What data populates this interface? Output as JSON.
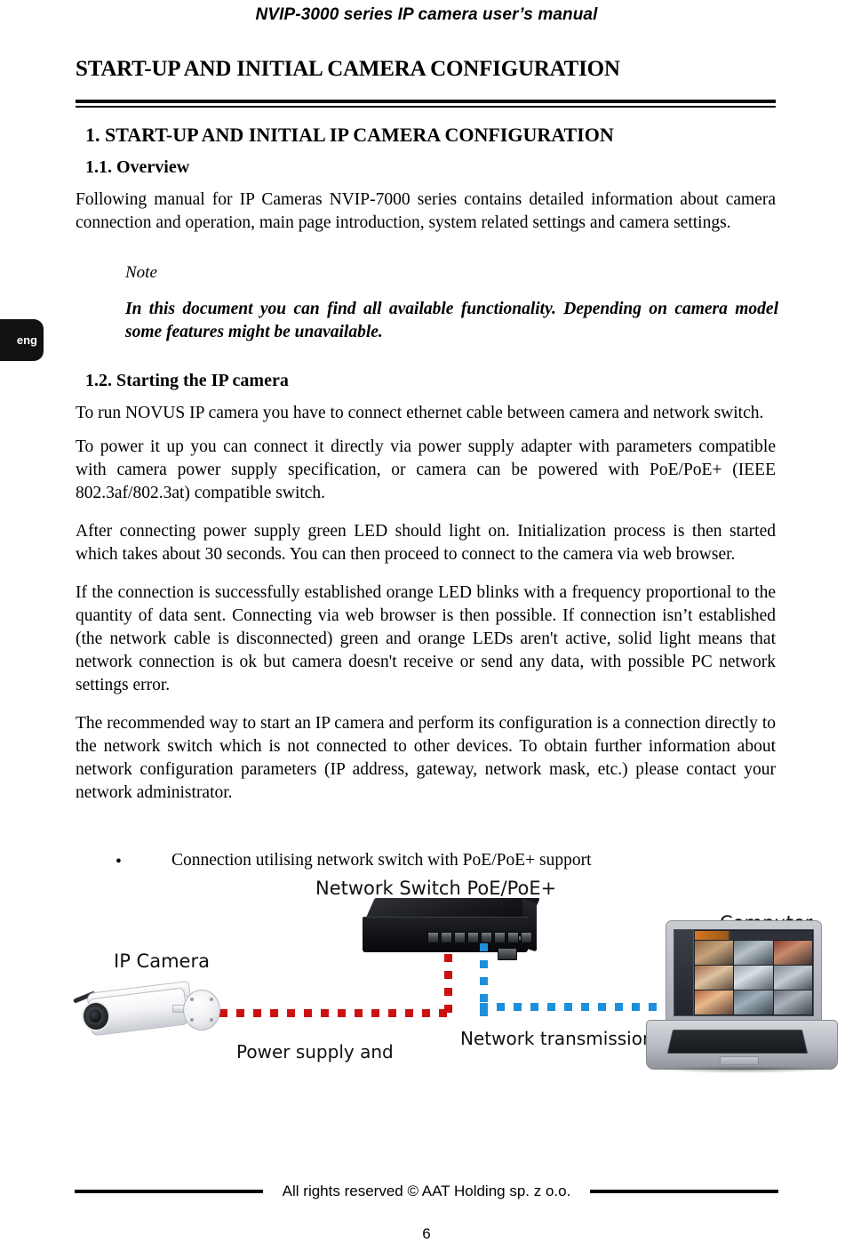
{
  "header": {
    "running_title": "NVIP-3000 series IP camera user’s manual"
  },
  "document": {
    "title": "START-UP AND INITIAL CAMERA CONFIGURATION",
    "section_1_heading": "1. START-UP AND INITIAL IP CAMERA CONFIGURATION",
    "section_1_1_heading": "1.1. Overview",
    "section_1_1_paragraph": "Following manual for IP Cameras NVIP-7000 series contains detailed information about camera connection and operation, main page introduction, system related settings and camera settings.",
    "note_label": "Note",
    "note_text": "In this document you can find all available functionality. Depending on camera model some features might be unavailable.",
    "section_1_2_heading": "1.2. Starting the IP camera",
    "paragraphs": [
      "To run NOVUS IP camera you have to connect ethernet cable between camera and network switch.",
      "To power it up you can connect it directly via power supply adapter with parameters compatible with camera power supply specification, or camera can be powered with PoE/PoE+ (IEEE 802.3af/802.3at) compatible switch.",
      "After connecting power supply green LED should light on. Initialization  process is then started which takes about 30 seconds. You can then proceed to connect to the camera via web browser.",
      "If the connection is successfully established orange LED  blinks with a frequency proportional to the quantity of data sent. Connecting via web browser is then possible. If connection isn’t established (the network cable is disconnected) green and orange LEDs aren't active, solid light means that network connection is ok but camera doesn't receive or send any data, with possible PC network settings error.",
      "The recommended way to start an IP camera and perform its configuration is a connection directly to the network switch which is not connected to other devices. To obtain further information about network configuration parameters (IP address, gateway, network mask, etc.) please  contact your network administrator."
    ],
    "bullet": {
      "marker": "•",
      "text": "Connection utilising network switch with PoE/PoE+ support"
    }
  },
  "language_tab": {
    "label": "eng"
  },
  "diagram": {
    "labels": {
      "switch": "Network Switch  PoE/PoE+",
      "computer": "Computer",
      "camera": "IP Camera",
      "power_line": "Power supply and",
      "network_line": "Network transmission"
    },
    "colors": {
      "power_dash": "#CC1111",
      "network_dash": "#1E8FDC"
    }
  },
  "footer": {
    "copyright": "All rights reserved © AAT Holding sp. z o.o.",
    "page_number": "6"
  }
}
